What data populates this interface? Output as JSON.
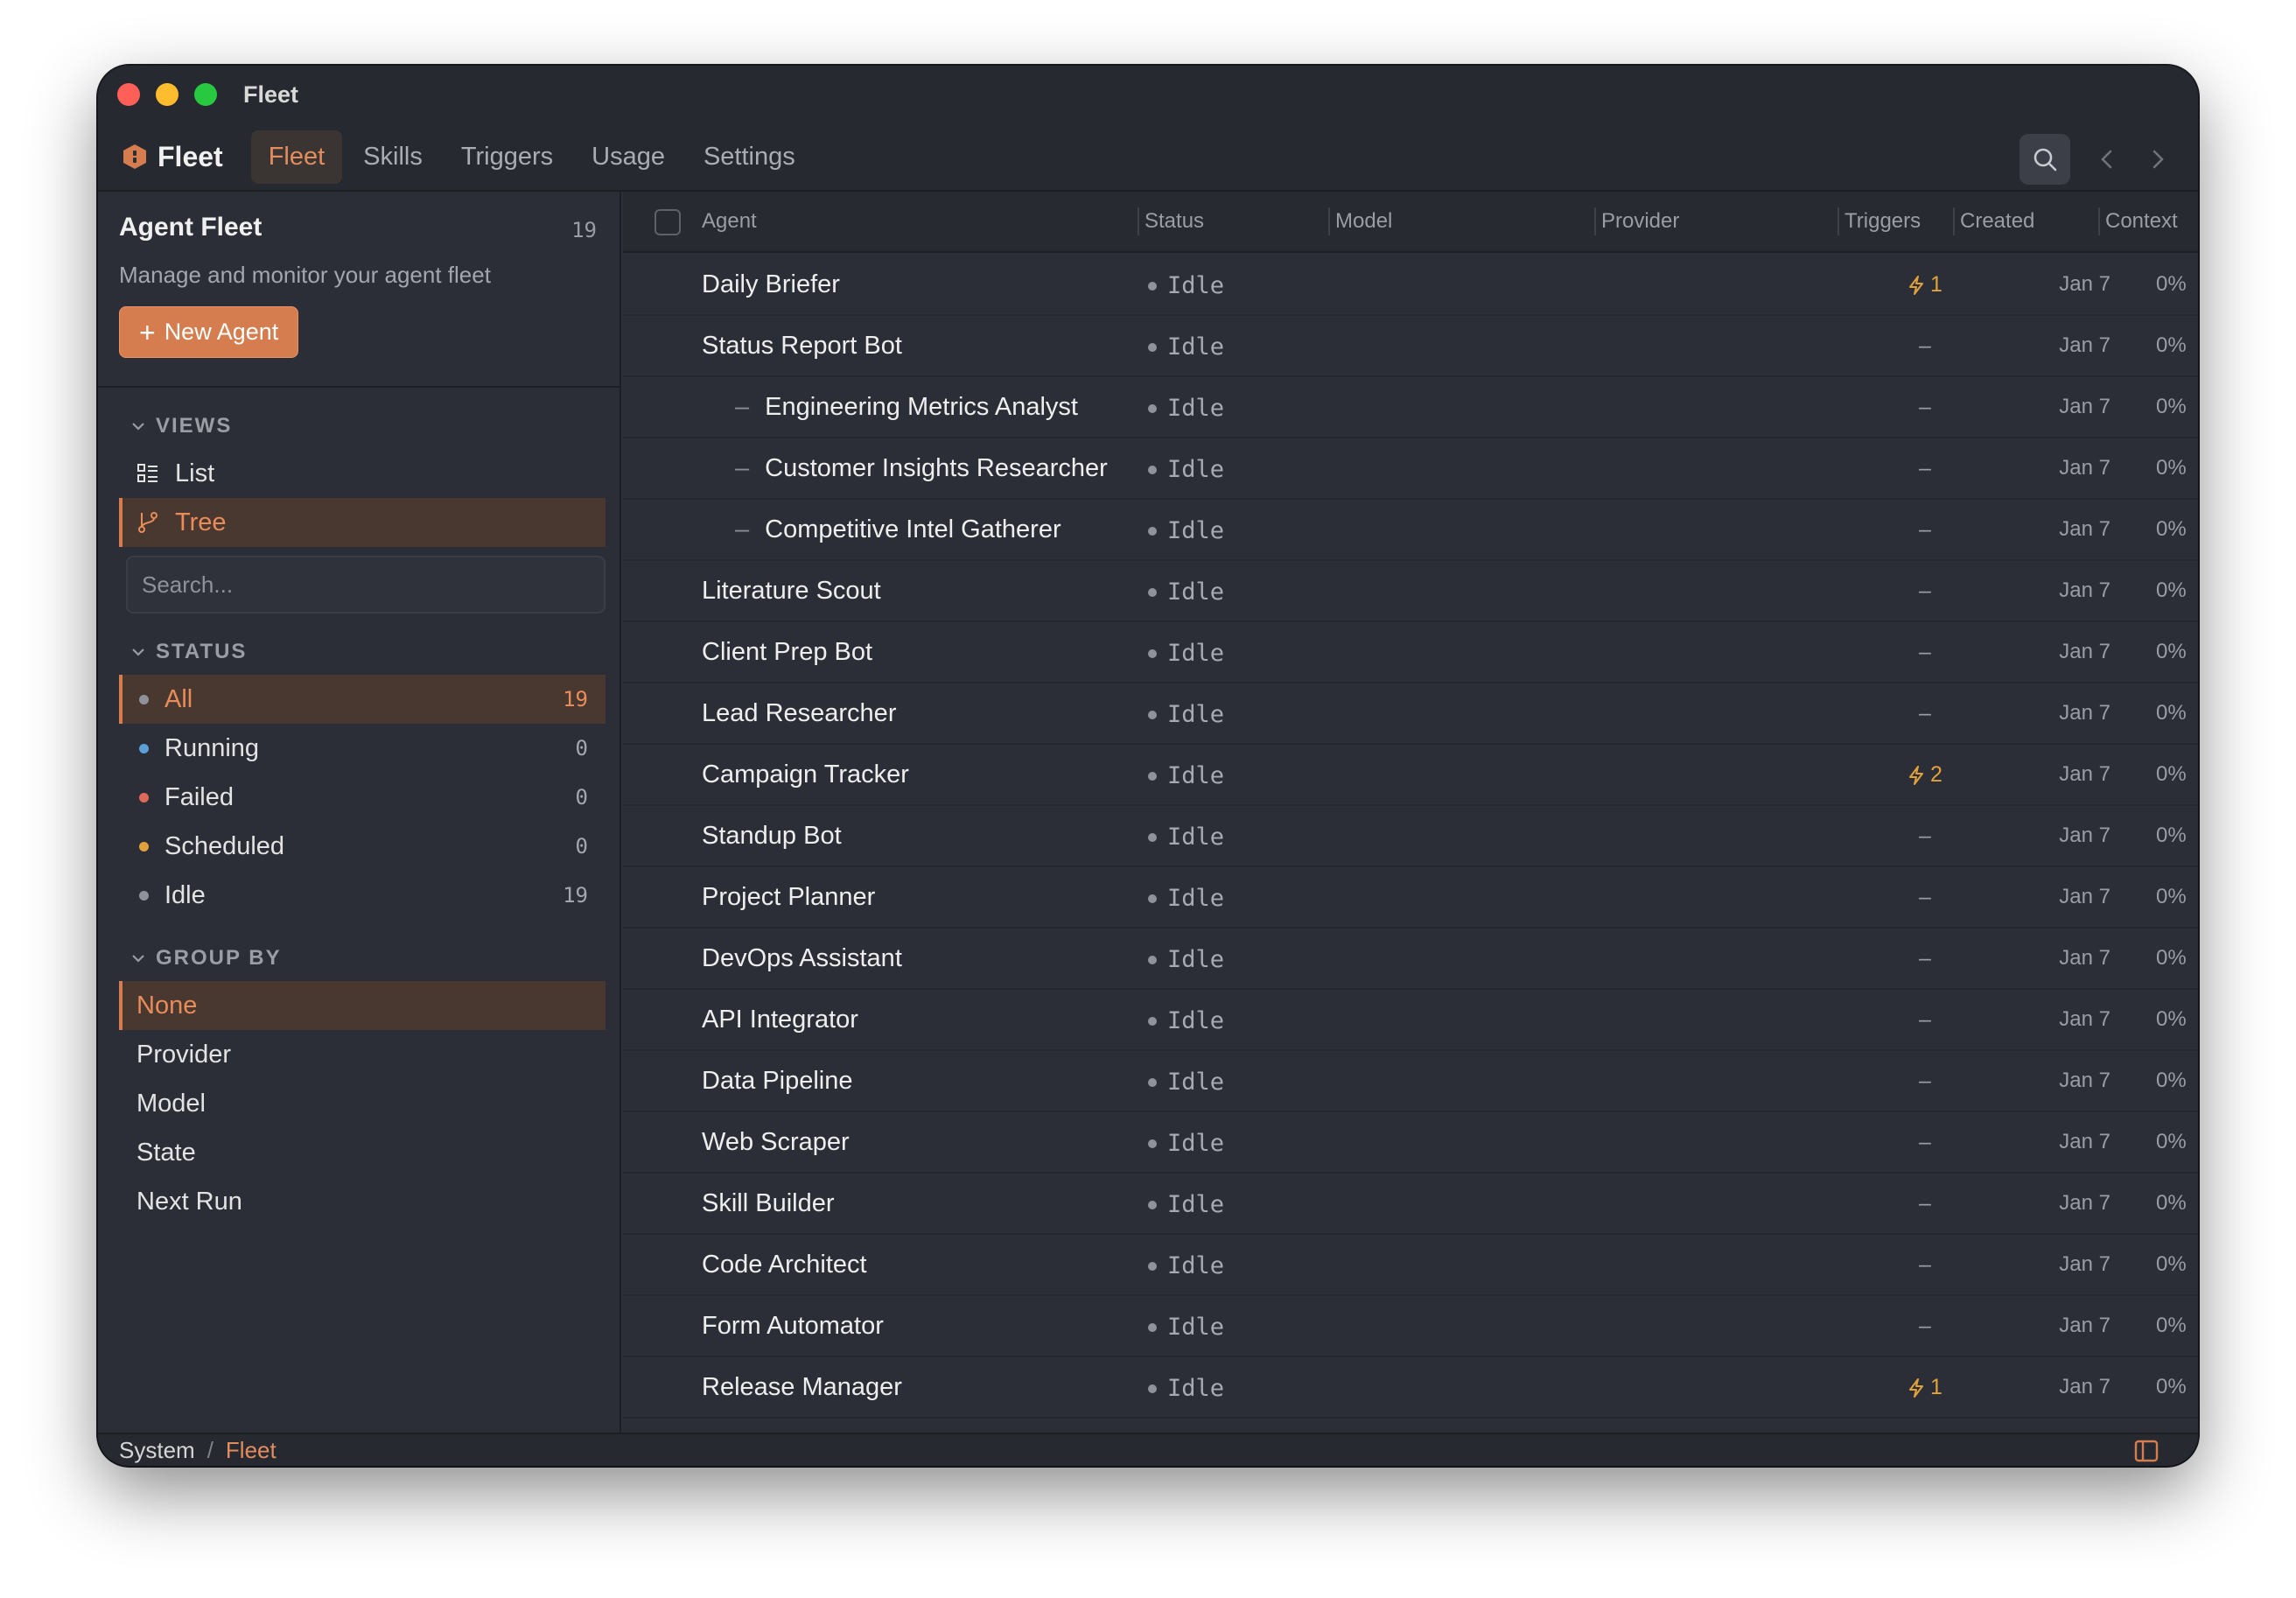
{
  "window": {
    "title": "Fleet"
  },
  "brand": {
    "name": "Fleet"
  },
  "nav": {
    "tabs": [
      "Fleet",
      "Skills",
      "Triggers",
      "Usage",
      "Settings"
    ],
    "active": 0
  },
  "sidebar": {
    "title": "Agent Fleet",
    "count": "19",
    "description": "Manage and monitor your agent fleet",
    "new_agent_label": "New Agent",
    "views": {
      "label": "VIEWS",
      "items": [
        {
          "label": "List",
          "icon": "list-icon"
        },
        {
          "label": "Tree",
          "icon": "branch-icon"
        }
      ],
      "active": 1
    },
    "search": {
      "placeholder": "Search..."
    },
    "status": {
      "label": "STATUS",
      "items": [
        {
          "label": "All",
          "count": "19",
          "color": "#8f929a"
        },
        {
          "label": "Running",
          "count": "0",
          "color": "#5b9fd6"
        },
        {
          "label": "Failed",
          "count": "0",
          "color": "#e06a5a"
        },
        {
          "label": "Scheduled",
          "count": "0",
          "color": "#e1a23c"
        },
        {
          "label": "Idle",
          "count": "19",
          "color": "#8f929a"
        }
      ],
      "active": 0
    },
    "group_by": {
      "label": "GROUP BY",
      "items": [
        "None",
        "Provider",
        "Model",
        "State",
        "Next Run"
      ],
      "active": 0
    }
  },
  "table": {
    "columns": {
      "agent": "Agent",
      "status": "Status",
      "model": "Model",
      "provider": "Provider",
      "triggers": "Triggers",
      "created": "Created",
      "context": "Context"
    },
    "rows": [
      {
        "agent": "Daily Briefer",
        "child": false,
        "status": "Idle",
        "triggers": "1",
        "has_trigger": true,
        "created": "Jan 7",
        "context": "0%"
      },
      {
        "agent": "Status Report Bot",
        "child": false,
        "status": "Idle",
        "triggers": "–",
        "has_trigger": false,
        "created": "Jan 7",
        "context": "0%"
      },
      {
        "agent": "Engineering Metrics Analyst",
        "child": true,
        "status": "Idle",
        "triggers": "–",
        "has_trigger": false,
        "created": "Jan 7",
        "context": "0%"
      },
      {
        "agent": "Customer Insights Researcher",
        "child": true,
        "status": "Idle",
        "triggers": "–",
        "has_trigger": false,
        "created": "Jan 7",
        "context": "0%"
      },
      {
        "agent": "Competitive Intel Gatherer",
        "child": true,
        "status": "Idle",
        "triggers": "–",
        "has_trigger": false,
        "created": "Jan 7",
        "context": "0%"
      },
      {
        "agent": "Literature Scout",
        "child": false,
        "status": "Idle",
        "triggers": "–",
        "has_trigger": false,
        "created": "Jan 7",
        "context": "0%"
      },
      {
        "agent": "Client Prep Bot",
        "child": false,
        "status": "Idle",
        "triggers": "–",
        "has_trigger": false,
        "created": "Jan 7",
        "context": "0%"
      },
      {
        "agent": "Lead Researcher",
        "child": false,
        "status": "Idle",
        "triggers": "–",
        "has_trigger": false,
        "created": "Jan 7",
        "context": "0%"
      },
      {
        "agent": "Campaign Tracker",
        "child": false,
        "status": "Idle",
        "triggers": "2",
        "has_trigger": true,
        "created": "Jan 7",
        "context": "0%"
      },
      {
        "agent": "Standup Bot",
        "child": false,
        "status": "Idle",
        "triggers": "–",
        "has_trigger": false,
        "created": "Jan 7",
        "context": "0%"
      },
      {
        "agent": "Project Planner",
        "child": false,
        "status": "Idle",
        "triggers": "–",
        "has_trigger": false,
        "created": "Jan 7",
        "context": "0%"
      },
      {
        "agent": "DevOps Assistant",
        "child": false,
        "status": "Idle",
        "triggers": "–",
        "has_trigger": false,
        "created": "Jan 7",
        "context": "0%"
      },
      {
        "agent": "API Integrator",
        "child": false,
        "status": "Idle",
        "triggers": "–",
        "has_trigger": false,
        "created": "Jan 7",
        "context": "0%"
      },
      {
        "agent": "Data Pipeline",
        "child": false,
        "status": "Idle",
        "triggers": "–",
        "has_trigger": false,
        "created": "Jan 7",
        "context": "0%"
      },
      {
        "agent": "Web Scraper",
        "child": false,
        "status": "Idle",
        "triggers": "–",
        "has_trigger": false,
        "created": "Jan 7",
        "context": "0%"
      },
      {
        "agent": "Skill Builder",
        "child": false,
        "status": "Idle",
        "triggers": "–",
        "has_trigger": false,
        "created": "Jan 7",
        "context": "0%"
      },
      {
        "agent": "Code Architect",
        "child": false,
        "status": "Idle",
        "triggers": "–",
        "has_trigger": false,
        "created": "Jan 7",
        "context": "0%"
      },
      {
        "agent": "Form Automator",
        "child": false,
        "status": "Idle",
        "triggers": "–",
        "has_trigger": false,
        "created": "Jan 7",
        "context": "0%"
      },
      {
        "agent": "Release Manager",
        "child": false,
        "status": "Idle",
        "triggers": "1",
        "has_trigger": true,
        "created": "Jan 7",
        "context": "0%"
      }
    ]
  },
  "statusbar": {
    "crumbs": [
      "System",
      "Fleet"
    ],
    "separator": "/"
  },
  "colors": {
    "accent": "#d57d4f",
    "trigger": "#e1a23c",
    "background": "#2b2e36"
  }
}
